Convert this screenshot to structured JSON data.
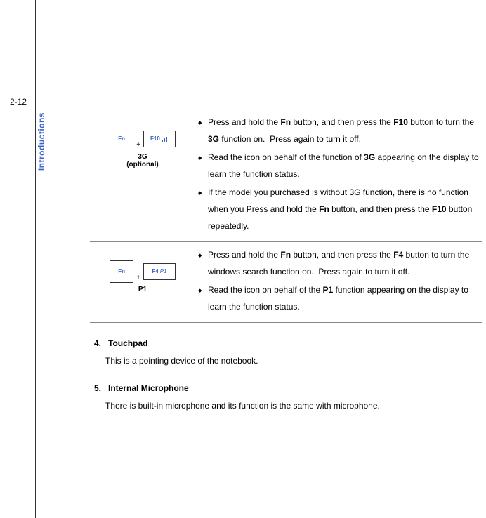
{
  "pageNumber": "2-12",
  "sideLabel": "Introductions",
  "rows": [
    {
      "fnLabel": "Fn",
      "secondKeyLabel": "F10",
      "caption": "3G",
      "subcaption": "(optional)",
      "bullets": [
        {
          "html": "Press and hold the <b>Fn</b> button, and then press the <b>F10</b> button to turn the <b>3G</b> function on.&nbsp;&nbsp;Press again to turn it off."
        },
        {
          "html": "Read the icon on behalf of the function of <b>3G</b> appearing on the display to learn the function status."
        },
        {
          "html": "If the model you purchased is without 3G function, there is no function when you Press and hold the <b>Fn</b> button, and then press the <b>F10</b> button repeatedly."
        }
      ]
    },
    {
      "fnLabel": "Fn",
      "secondKeyLabel": "F4",
      "secondKeyExtra": "P1",
      "caption": "P1",
      "subcaption": "",
      "bullets": [
        {
          "html": "Press and hold the <b>Fn</b> button, and then press the <b>F4</b> button to turn the windows search function on.&nbsp;&nbsp;Press again to turn it off."
        },
        {
          "html": "Read the icon on behalf of the <b>P1</b> function appearing on the display to learn the function status."
        }
      ]
    }
  ],
  "sections": [
    {
      "num": "4.",
      "title": "Touchpad",
      "body": "This is a pointing device of the notebook."
    },
    {
      "num": "5.",
      "title": "Internal Microphone",
      "body": "There is built-in microphone and its function is the same with microphone."
    }
  ]
}
